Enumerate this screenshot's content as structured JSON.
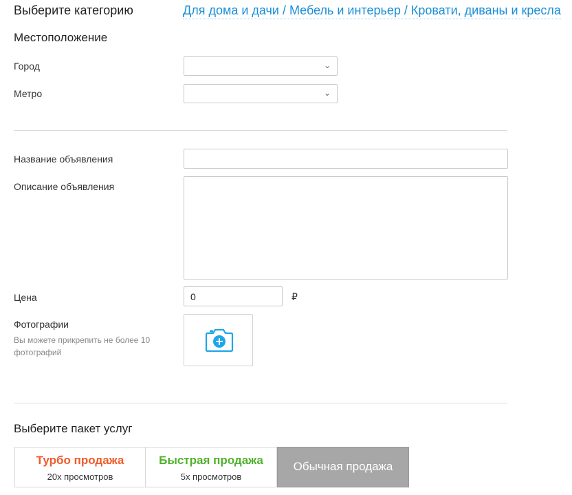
{
  "category": {
    "label": "Выберите категорию",
    "path": "Для дома и дачи / Мебель и интерьер / Кровати, диваны и кресла"
  },
  "location": {
    "title": "Местоположение",
    "city_label": "Город",
    "city_value": "",
    "metro_label": "Метро",
    "metro_value": ""
  },
  "ad": {
    "name_label": "Название объявления",
    "name_value": "",
    "description_label": "Описание объявления",
    "description_value": "",
    "price_label": "Цена",
    "price_value": "0",
    "currency": "₽"
  },
  "photos": {
    "label": "Фотографии",
    "hint": "Вы можете прикрепить не более 10 фотографий",
    "add_icon": "camera-plus-icon"
  },
  "packages": {
    "title": "Выберите пакет услуг",
    "items": [
      {
        "name": "Турбо продажа",
        "views": "20x просмотров",
        "color": "#f05a28"
      },
      {
        "name": "Быстрая продажа",
        "views": "5x просмотров",
        "color": "#4fb12c"
      },
      {
        "name": "Обычная продажа",
        "views": "",
        "color": "#a7a7a7",
        "selected": true
      }
    ]
  },
  "colors": {
    "link": "#1a8ed6",
    "icon_accent": "#1ea7e8"
  }
}
